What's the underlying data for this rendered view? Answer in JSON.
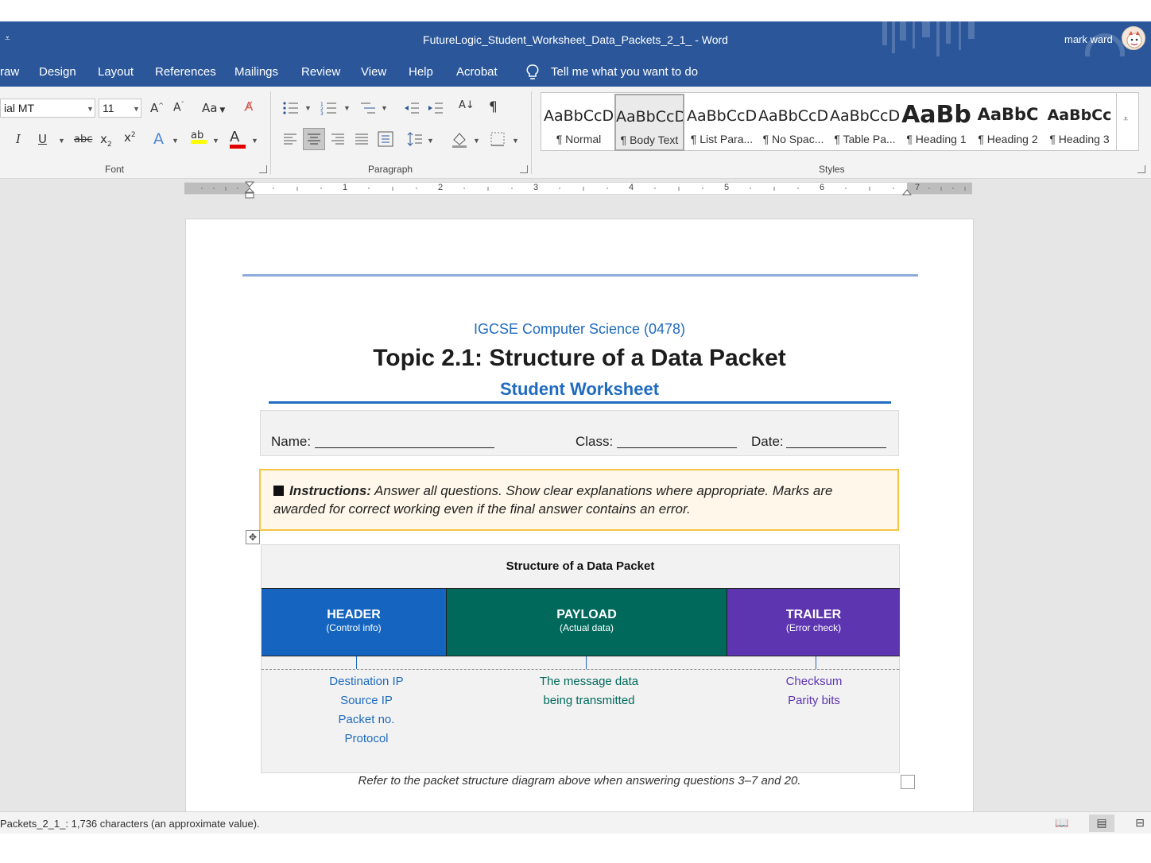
{
  "window": {
    "title": "FutureLogic_Student_Worksheet_Data_Packets_2_1_  -  Word",
    "user_name": "mark ward"
  },
  "menu": {
    "tabs": [
      "raw",
      "Design",
      "Layout",
      "References",
      "Mailings",
      "Review",
      "View",
      "Help",
      "Acrobat"
    ],
    "tell_me": "Tell me what you want to do"
  },
  "ribbon": {
    "font": {
      "name": "ial MT",
      "size": "11",
      "group_label": "Font",
      "highlight_color": "#ffff00",
      "font_color": "#e00000"
    },
    "paragraph": {
      "group_label": "Paragraph"
    },
    "styles": {
      "group_label": "Styles",
      "items": [
        {
          "sample": "AaBbCcD",
          "name": "¶ Normal"
        },
        {
          "sample": "AaBbCcD",
          "name": "¶ Body Text"
        },
        {
          "sample": "AaBbCcD",
          "name": "¶ List Para..."
        },
        {
          "sample": "AaBbCcD",
          "name": "¶ No Spac..."
        },
        {
          "sample": "AaBbCcD",
          "name": "¶ Table Pa..."
        },
        {
          "sample": "AaBb",
          "name": "¶ Heading 1"
        },
        {
          "sample": "AaBbC",
          "name": "¶ Heading 2"
        },
        {
          "sample": "AaBbCc",
          "name": "¶ Heading 3"
        }
      ]
    }
  },
  "ruler": {
    "numbers": [
      "1",
      "2",
      "3",
      "4",
      "5",
      "6",
      "7"
    ]
  },
  "document": {
    "course": "IGCSE Computer Science (0478)",
    "title": "Topic 2.1: Structure of a Data Packet",
    "subtitle": "Student Worksheet",
    "fields": {
      "name": "Name:",
      "class": "Class:",
      "date": "Date:"
    },
    "instructions": {
      "label": "Instructions:",
      "text": "Answer all questions. Show clear explanations where appropriate. Marks are awarded for correct working even if the final answer contains an error."
    },
    "packet_diagram": {
      "title": "Structure of a Data Packet",
      "segments": [
        {
          "name": "HEADER",
          "desc": "(Control info)",
          "color": "#1565c0",
          "detail_color": "#1f6bbf",
          "details": [
            "Destination IP",
            "Source IP",
            "Packet no.",
            "Protocol"
          ]
        },
        {
          "name": "PAYLOAD",
          "desc": "(Actual data)",
          "color": "#00695c",
          "detail_color": "#00695c",
          "details": [
            "The message data",
            "being transmitted"
          ]
        },
        {
          "name": "TRAILER",
          "desc": "(Error check)",
          "color": "#5e35b1",
          "detail_color": "#5e35b1",
          "details": [
            "Checksum",
            "Parity bits"
          ]
        }
      ]
    },
    "footnote": "Refer to the packet structure diagram above when answering questions 3–7 and 20."
  },
  "status": {
    "text": "Packets_2_1_: 1,736 characters (an approximate value)."
  },
  "colors": {
    "word_blue": "#2b579a",
    "accent_blue": "#1f6bbf",
    "instructions_border": "#f6c445"
  }
}
